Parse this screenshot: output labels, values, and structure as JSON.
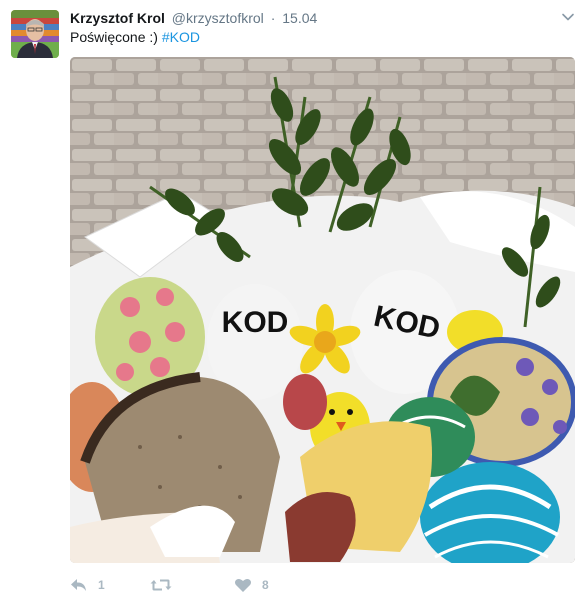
{
  "tweet": {
    "author_name": "Krzysztof Krol",
    "author_handle": "@krzysztofkrol",
    "separator": "·",
    "date": "15.04",
    "text_plain": "Poświęcone :) ",
    "text_hashtag": "#KOD",
    "image_text": {
      "egg_left": "KOD",
      "egg_right": "KOD"
    }
  },
  "actions": {
    "reply_count": "1",
    "retweet_count": "",
    "like_count": "8"
  },
  "colors": {
    "text": "#14171a",
    "secondary": "#657786",
    "link": "#1b95e0",
    "action_icon": "#aab8c2"
  }
}
